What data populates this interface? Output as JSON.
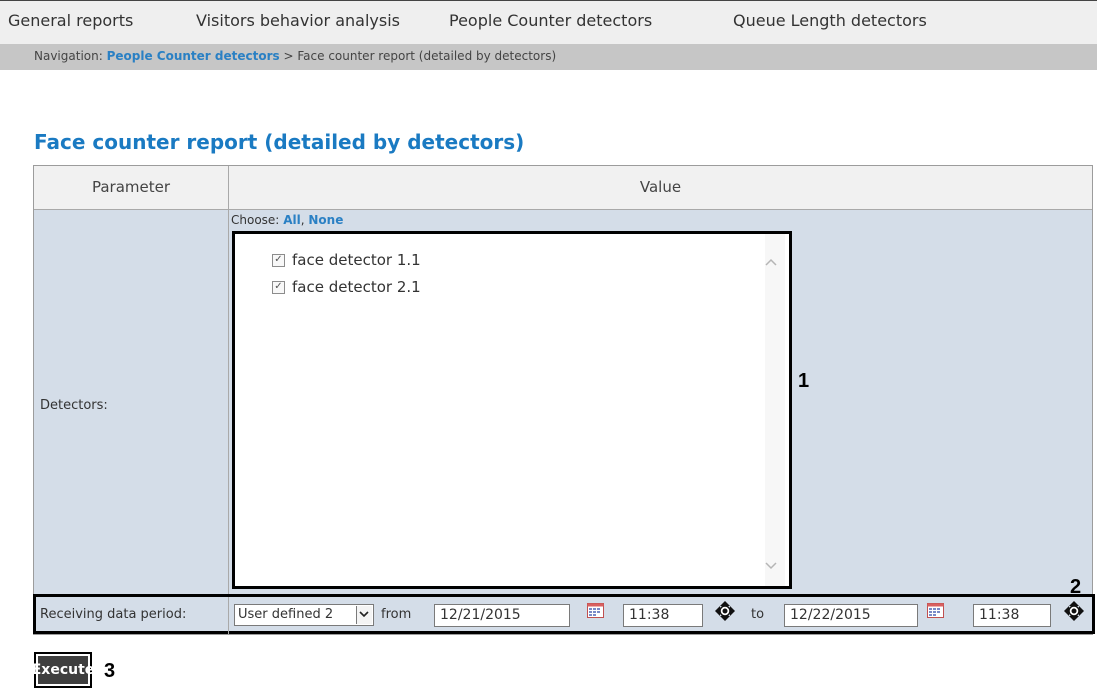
{
  "topnav": {
    "tabs": [
      {
        "label": "General reports"
      },
      {
        "label": "Visitors behavior analysis"
      },
      {
        "label": "People Counter detectors"
      },
      {
        "label": "Queue Length detectors"
      }
    ]
  },
  "breadcrumb": {
    "prefix": "Navigation:",
    "link": "People Counter detectors",
    "separator": ">",
    "current": "Face counter report (detailed by detectors)"
  },
  "page": {
    "title": "Face counter report (detailed by detectors)"
  },
  "table": {
    "header_parameter": "Parameter",
    "header_value": "Value",
    "detectors": {
      "label": "Detectors:",
      "choose_label": "Choose:",
      "choose_all": "All",
      "choose_none": "None",
      "items": [
        {
          "label": "face detector 1.1",
          "checked": true
        },
        {
          "label": "face detector 2.1",
          "checked": true
        }
      ]
    },
    "period": {
      "label": "Receiving data period:",
      "selected": "User defined 2",
      "from_label": "from",
      "from_date": "12/21/2015",
      "from_time": "11:38",
      "to_label": "to",
      "to_date": "12/22/2015",
      "to_time": "11:38"
    }
  },
  "execute_label": "Execute",
  "annotations": {
    "one": "1",
    "two": "2",
    "three": "3"
  },
  "colors": {
    "accent": "#1a7ac2",
    "link": "#2a80c4",
    "row_bg": "#d4dde8",
    "execute_bg": "#3f3f3f"
  }
}
